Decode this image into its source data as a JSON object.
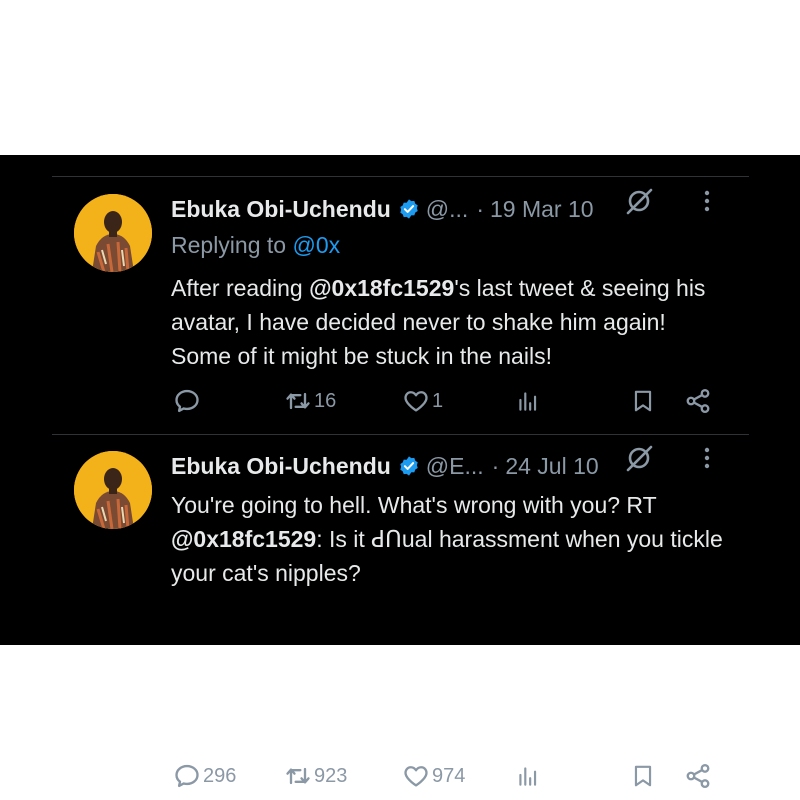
{
  "tweets": [
    {
      "author_name": "Ebuka Obi-Uchendu",
      "handle": "@...",
      "separator": "·",
      "date": "19 Mar 10",
      "reply_prefix": "Replying to",
      "reply_mention": "@0x",
      "text": {
        "part1": "After reading ",
        "mention": "@0x18fc1529",
        "part2": "'s last tweet & seeing his avatar, I have decided never to shake him again! Some of it might be stuck in the nails!"
      },
      "actions": {
        "replies": "",
        "retweets": "16",
        "likes": "1"
      }
    },
    {
      "author_name": "Ebuka Obi-Uchendu",
      "handle": "@E...",
      "separator": "·",
      "date": "24 Jul 10",
      "text": {
        "part1": "You're going to hell. What's wrong with you? RT ",
        "mention": "@0x18fc1529",
        "part2": ": Is it ꓒꓵual harassment when you tickle your cat's nipples?"
      },
      "actions": {
        "replies": "296",
        "retweets": "923",
        "likes": "974"
      }
    }
  ],
  "icons": {
    "verified": "verified-badge-icon",
    "grok": "grok-icon",
    "more": "more-vertical-icon",
    "reply": "reply-icon",
    "retweet": "retweet-icon",
    "like": "heart-icon",
    "views": "views-icon",
    "bookmark": "bookmark-icon",
    "share": "share-icon"
  },
  "colors": {
    "background": "#000000",
    "text": "#e7e9ea",
    "secondary": "#8b98a5",
    "accent": "#1d9bf0",
    "verified": "#1d9bf0"
  }
}
